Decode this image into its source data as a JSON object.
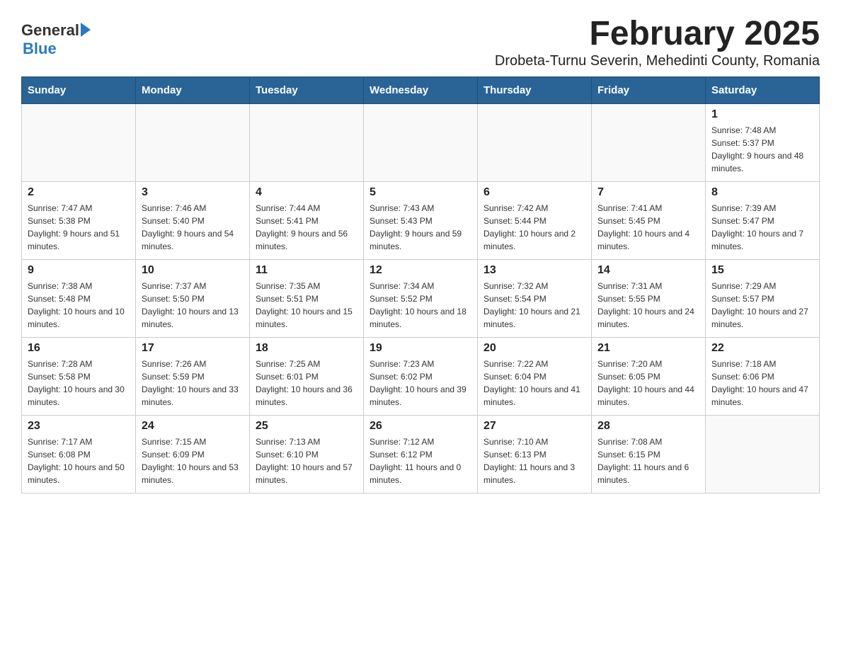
{
  "header": {
    "logo_general": "General",
    "logo_blue": "Blue",
    "title": "February 2025",
    "subtitle": "Drobeta-Turnu Severin, Mehedinti County, Romania"
  },
  "weekdays": [
    "Sunday",
    "Monday",
    "Tuesday",
    "Wednesday",
    "Thursday",
    "Friday",
    "Saturday"
  ],
  "rows": [
    [
      {
        "day": "",
        "info": ""
      },
      {
        "day": "",
        "info": ""
      },
      {
        "day": "",
        "info": ""
      },
      {
        "day": "",
        "info": ""
      },
      {
        "day": "",
        "info": ""
      },
      {
        "day": "",
        "info": ""
      },
      {
        "day": "1",
        "info": "Sunrise: 7:48 AM\nSunset: 5:37 PM\nDaylight: 9 hours and 48 minutes."
      }
    ],
    [
      {
        "day": "2",
        "info": "Sunrise: 7:47 AM\nSunset: 5:38 PM\nDaylight: 9 hours and 51 minutes."
      },
      {
        "day": "3",
        "info": "Sunrise: 7:46 AM\nSunset: 5:40 PM\nDaylight: 9 hours and 54 minutes."
      },
      {
        "day": "4",
        "info": "Sunrise: 7:44 AM\nSunset: 5:41 PM\nDaylight: 9 hours and 56 minutes."
      },
      {
        "day": "5",
        "info": "Sunrise: 7:43 AM\nSunset: 5:43 PM\nDaylight: 9 hours and 59 minutes."
      },
      {
        "day": "6",
        "info": "Sunrise: 7:42 AM\nSunset: 5:44 PM\nDaylight: 10 hours and 2 minutes."
      },
      {
        "day": "7",
        "info": "Sunrise: 7:41 AM\nSunset: 5:45 PM\nDaylight: 10 hours and 4 minutes."
      },
      {
        "day": "8",
        "info": "Sunrise: 7:39 AM\nSunset: 5:47 PM\nDaylight: 10 hours and 7 minutes."
      }
    ],
    [
      {
        "day": "9",
        "info": "Sunrise: 7:38 AM\nSunset: 5:48 PM\nDaylight: 10 hours and 10 minutes."
      },
      {
        "day": "10",
        "info": "Sunrise: 7:37 AM\nSunset: 5:50 PM\nDaylight: 10 hours and 13 minutes."
      },
      {
        "day": "11",
        "info": "Sunrise: 7:35 AM\nSunset: 5:51 PM\nDaylight: 10 hours and 15 minutes."
      },
      {
        "day": "12",
        "info": "Sunrise: 7:34 AM\nSunset: 5:52 PM\nDaylight: 10 hours and 18 minutes."
      },
      {
        "day": "13",
        "info": "Sunrise: 7:32 AM\nSunset: 5:54 PM\nDaylight: 10 hours and 21 minutes."
      },
      {
        "day": "14",
        "info": "Sunrise: 7:31 AM\nSunset: 5:55 PM\nDaylight: 10 hours and 24 minutes."
      },
      {
        "day": "15",
        "info": "Sunrise: 7:29 AM\nSunset: 5:57 PM\nDaylight: 10 hours and 27 minutes."
      }
    ],
    [
      {
        "day": "16",
        "info": "Sunrise: 7:28 AM\nSunset: 5:58 PM\nDaylight: 10 hours and 30 minutes."
      },
      {
        "day": "17",
        "info": "Sunrise: 7:26 AM\nSunset: 5:59 PM\nDaylight: 10 hours and 33 minutes."
      },
      {
        "day": "18",
        "info": "Sunrise: 7:25 AM\nSunset: 6:01 PM\nDaylight: 10 hours and 36 minutes."
      },
      {
        "day": "19",
        "info": "Sunrise: 7:23 AM\nSunset: 6:02 PM\nDaylight: 10 hours and 39 minutes."
      },
      {
        "day": "20",
        "info": "Sunrise: 7:22 AM\nSunset: 6:04 PM\nDaylight: 10 hours and 41 minutes."
      },
      {
        "day": "21",
        "info": "Sunrise: 7:20 AM\nSunset: 6:05 PM\nDaylight: 10 hours and 44 minutes."
      },
      {
        "day": "22",
        "info": "Sunrise: 7:18 AM\nSunset: 6:06 PM\nDaylight: 10 hours and 47 minutes."
      }
    ],
    [
      {
        "day": "23",
        "info": "Sunrise: 7:17 AM\nSunset: 6:08 PM\nDaylight: 10 hours and 50 minutes."
      },
      {
        "day": "24",
        "info": "Sunrise: 7:15 AM\nSunset: 6:09 PM\nDaylight: 10 hours and 53 minutes."
      },
      {
        "day": "25",
        "info": "Sunrise: 7:13 AM\nSunset: 6:10 PM\nDaylight: 10 hours and 57 minutes."
      },
      {
        "day": "26",
        "info": "Sunrise: 7:12 AM\nSunset: 6:12 PM\nDaylight: 11 hours and 0 minutes."
      },
      {
        "day": "27",
        "info": "Sunrise: 7:10 AM\nSunset: 6:13 PM\nDaylight: 11 hours and 3 minutes."
      },
      {
        "day": "28",
        "info": "Sunrise: 7:08 AM\nSunset: 6:15 PM\nDaylight: 11 hours and 6 minutes."
      },
      {
        "day": "",
        "info": ""
      }
    ]
  ]
}
